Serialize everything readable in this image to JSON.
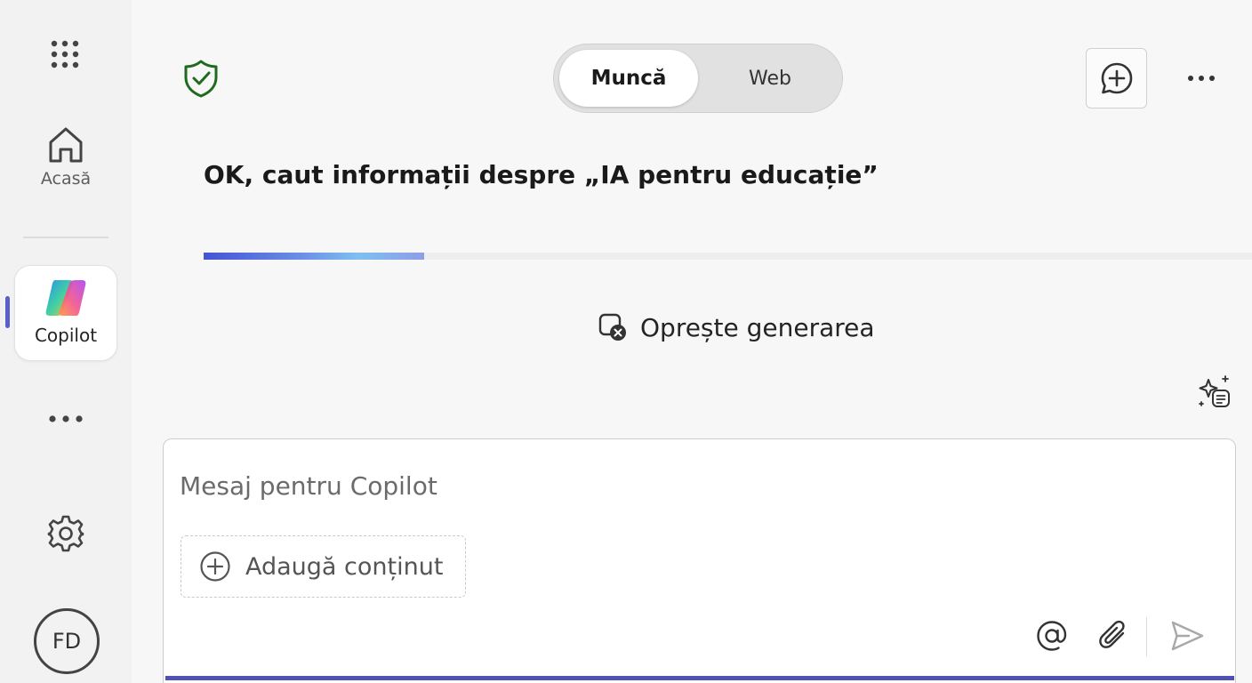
{
  "rail": {
    "apps_icon": "waffle-grid-icon",
    "home": {
      "icon": "home-icon",
      "label": "Acasă"
    },
    "copilot": {
      "icon": "copilot-logo-icon",
      "label": "Copilot"
    },
    "more_icon": "more-horizontal-icon",
    "settings_icon": "gear-icon",
    "avatar_initials": "FD"
  },
  "header": {
    "shield_icon": "shield-check-icon",
    "shield_color": "#1e6b1e",
    "mode_toggle": {
      "work_label": "Muncă",
      "web_label": "Web",
      "selected": "Muncă"
    },
    "new_chat_icon": "chat-add-icon",
    "more_icon": "more-horizontal-icon"
  },
  "main": {
    "status_text": "OK, caut informații despre „IA pentru educație”",
    "progress": 0.21,
    "stop_generating": {
      "icon": "stop-generating-icon",
      "label": "Oprește generarea"
    },
    "prompt_gallery_icon": "sparkle-list-icon"
  },
  "composer": {
    "placeholder": "Mesaj pentru Copilot",
    "value": "",
    "add_content": {
      "icon": "add-circle-icon",
      "label": "Adaugă conținut"
    },
    "mention_icon": "at-mention-icon",
    "attach_icon": "paperclip-icon",
    "send_icon": "send-icon"
  },
  "colors": {
    "accent": "#5b5fc7",
    "composer_underline": "#4f52b2",
    "background": "#f7f7f7"
  }
}
